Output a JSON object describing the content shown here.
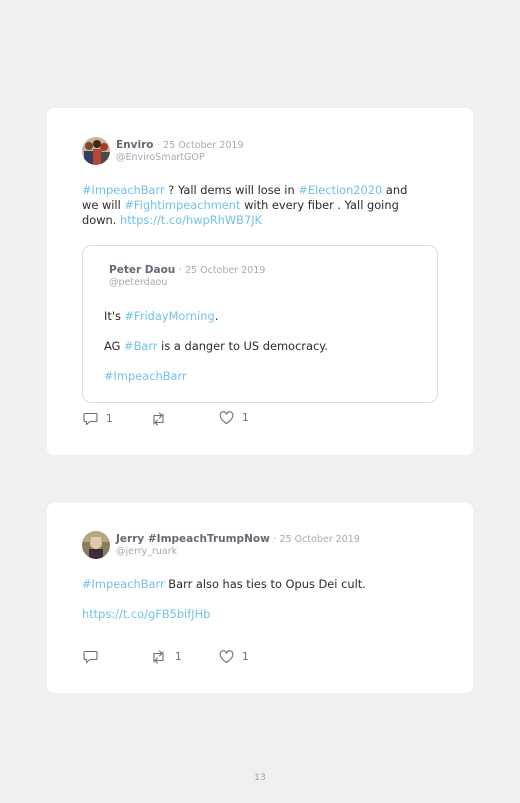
{
  "tweets": [
    {
      "author": "Enviro",
      "date": "· 25 October 2019",
      "handle": "@EnviroSmartGOP",
      "line1": {
        "tag1": "#ImpeachBarr",
        "t1": " ? Yall dems will lose in ",
        "tag2": "#Election2020",
        "t2": " and"
      },
      "line2": {
        "t1": "we will ",
        "tag1": "#Fightimpeachment",
        "t2": " with every fiber . Yall going"
      },
      "line3": {
        "t1": "down. ",
        "link": "https://t.co/hwpRhWB7JK"
      },
      "quote": {
        "author": "Peter Daou",
        "date": "· 25 October 2019",
        "handle": "@peterdaou",
        "p1": {
          "t1": "It's ",
          "tag": "#FridayMorning",
          "t2": "."
        },
        "p2": {
          "t1": "AG ",
          "tag": "#Barr",
          "t2": " is a danger to US democracy."
        },
        "p3": {
          "tag": "#ImpeachBarr"
        }
      },
      "actions": {
        "reply": "1",
        "retweet": "",
        "like": "1"
      }
    },
    {
      "author": "Jerry #ImpeachTrumpNow",
      "date": "· 25 October 2019",
      "handle": "@jerry_ruark",
      "line1": {
        "tag1": "#ImpeachBarr",
        "t1": " Barr also has ties to Opus Dei cult."
      },
      "line2": {
        "link": "https://t.co/gFB5bifJHb"
      },
      "actions": {
        "reply": "",
        "retweet": "1",
        "like": "1"
      }
    }
  ],
  "page_number": "13",
  "colors": {
    "hashtag": "#6ec3ec",
    "background": "#f0f0f1",
    "card": "#ffffff"
  }
}
